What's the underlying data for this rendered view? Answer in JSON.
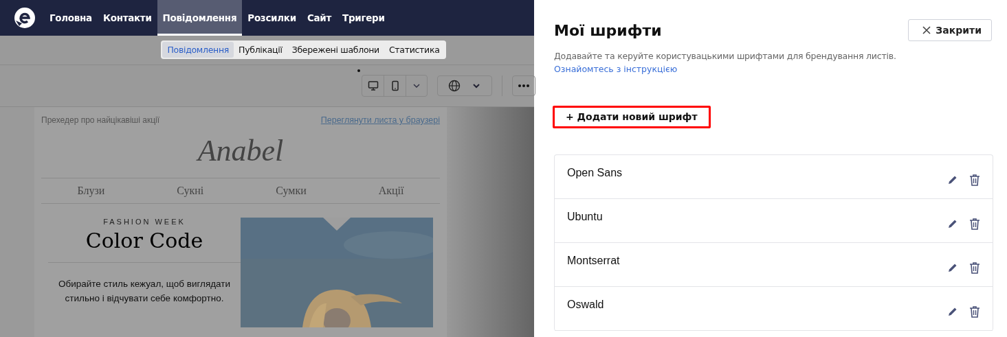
{
  "nav": {
    "items": [
      {
        "label": "Головна",
        "selected": false
      },
      {
        "label": "Контакти",
        "selected": false
      },
      {
        "label": "Повідомлення",
        "selected": true
      },
      {
        "label": "Розсилки",
        "selected": false
      },
      {
        "label": "Сайт",
        "selected": false
      },
      {
        "label": "Тригери",
        "selected": false
      }
    ]
  },
  "subtabs": [
    {
      "label": "Повідомлення",
      "selected": true
    },
    {
      "label": "Публікації",
      "selected": false
    },
    {
      "label": "Збережені шаблони",
      "selected": false
    },
    {
      "label": "Статистика",
      "selected": false
    }
  ],
  "email": {
    "preheader": "Прехедер про найцікавіші акції",
    "view_link": "Переглянути листа у браузері",
    "logo": "Anabel",
    "menu": [
      "Блузи",
      "Сукні",
      "Сумки",
      "Акції"
    ],
    "kicker": "FASHION WEEK",
    "heading": "Color Code",
    "body": "Обирайте стиль кежуал, щоб виглядати стильно і відчувати себе комфортно."
  },
  "panel": {
    "title": "Мої шрифти",
    "close": "Закрити",
    "description": "Додавайте та керуйте користувацькими шрифтами для брендування листів.",
    "link": "Ознайомтесь з інструкцією",
    "add_button": "+ Додати новий шрифт",
    "fonts": [
      {
        "name": "Open Sans"
      },
      {
        "name": "Ubuntu"
      },
      {
        "name": "Montserrat"
      },
      {
        "name": "Oswald"
      }
    ]
  }
}
